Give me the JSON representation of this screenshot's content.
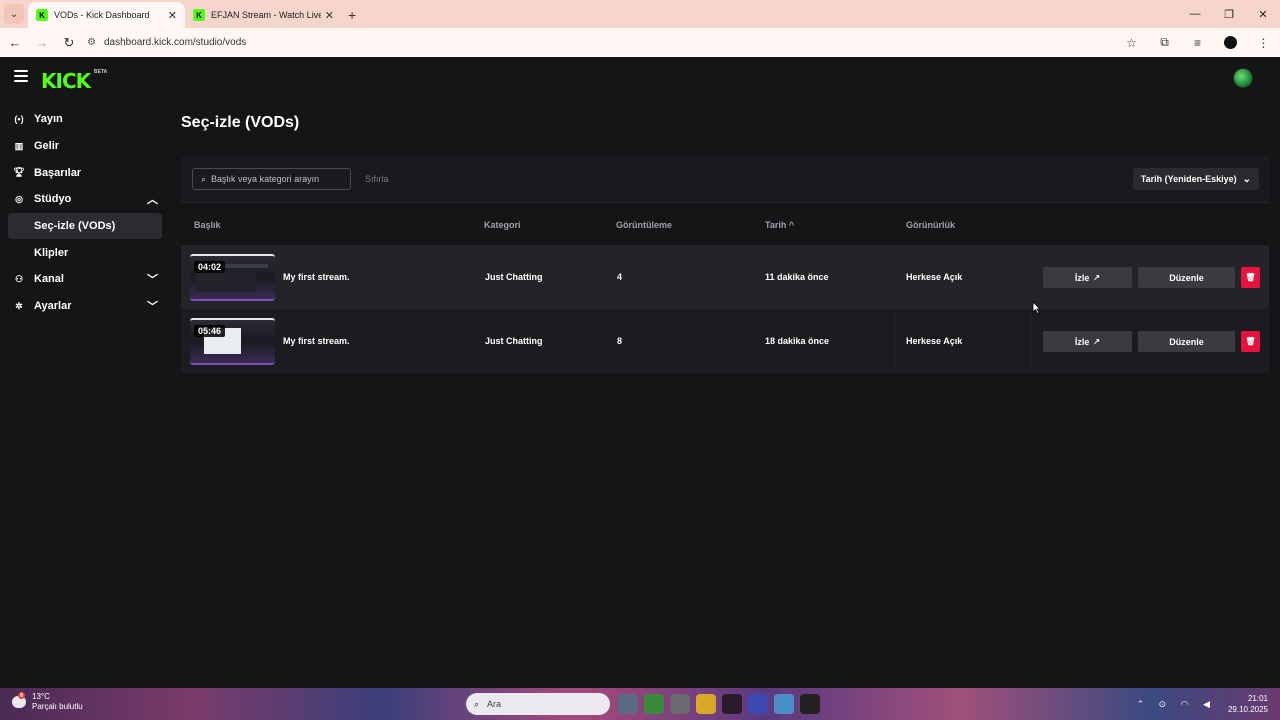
{
  "browser": {
    "tabs": [
      {
        "title": "VODs - Kick Dashboard",
        "active": true
      },
      {
        "title": "EFJAN Stream - Watch Live on Kick",
        "active": false
      }
    ],
    "url": "dashboard.kick.com/studio/vods",
    "new_tab_label": "+"
  },
  "app": {
    "logo": "KICK",
    "logo_badge": "BETA",
    "brand_color": "#53fc18",
    "danger_color": "#e8123e"
  },
  "sidebar": {
    "items": [
      {
        "label": "Yayın",
        "icon": "broadcast-icon"
      },
      {
        "label": "Gelir",
        "icon": "revenue-icon"
      },
      {
        "label": "Başarılar",
        "icon": "trophy-icon"
      },
      {
        "label": "Stüdyo",
        "icon": "studio-icon",
        "expanded": true
      },
      {
        "label": "Seç-izle (VODs)",
        "sub": true,
        "active": true
      },
      {
        "label": "Klipler",
        "sub": true
      },
      {
        "label": "Kanal",
        "icon": "channel-icon",
        "expanded": false
      },
      {
        "label": "Ayarlar",
        "icon": "settings-icon",
        "expanded": false
      }
    ]
  },
  "page": {
    "title": "Seç-izle (VODs)"
  },
  "toolbar": {
    "search_placeholder": "Başlık veya kategori arayın",
    "reset_label": "Sıfırla",
    "sort_label": "Tarih (Yeniden-Eskiye)"
  },
  "table": {
    "columns": [
      "Başlık",
      "Kategori",
      "Görüntüleme",
      "Tarih",
      "Görünürlük"
    ],
    "sort_indicator": "^",
    "rows": [
      {
        "duration": "04:02",
        "title": "My first stream.",
        "category": "Just Chatting",
        "views": "4",
        "date": "11 dakika önce",
        "visibility": "Herkese Açık",
        "watch_label": "İzle",
        "edit_label": "Düzenle"
      },
      {
        "duration": "05:46",
        "title": "My first stream.",
        "category": "Just Chatting",
        "views": "8",
        "date": "18 dakika önce",
        "visibility": "Herkese Açık",
        "watch_label": "İzle",
        "edit_label": "Düzenle"
      }
    ]
  },
  "taskbar": {
    "weather_temp": "13°C",
    "weather_desc": "Parçalı bulutlu",
    "weather_badge": "8",
    "search_placeholder": "Ara",
    "time": "21:01",
    "date": "29.10.2025"
  }
}
